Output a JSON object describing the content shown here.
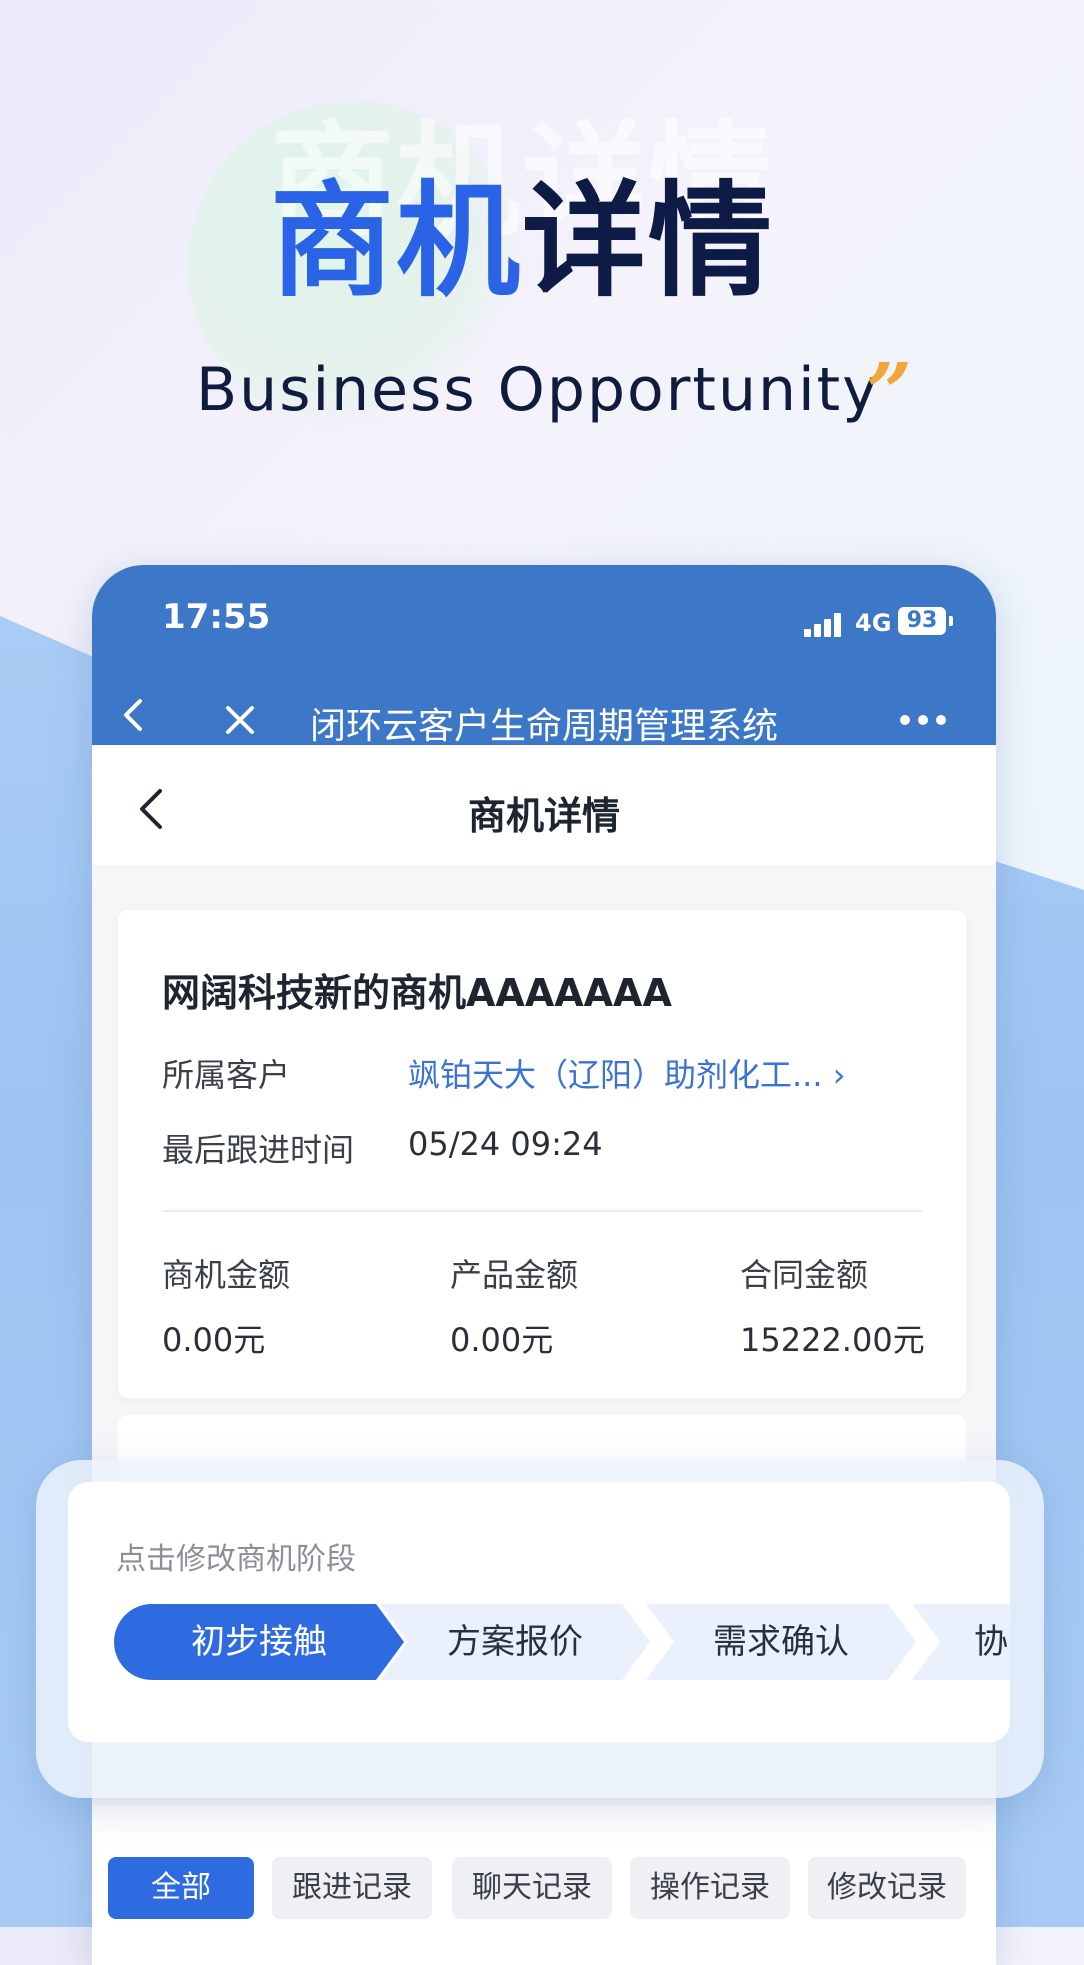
{
  "hero": {
    "title_part1": "商机",
    "title_part2": "详情",
    "ghost_text": "商机详情",
    "subtitle": "Business Opportunity",
    "quote_mark": "”"
  },
  "status_bar": {
    "time": "17:55",
    "network": "4G",
    "battery": "93"
  },
  "navbar": {
    "title": "闭环云客户生命周期管理系统"
  },
  "page": {
    "title": "商机详情"
  },
  "card": {
    "name": "网阔科技新的商机AAAAAAA",
    "customer_label": "所属客户",
    "customer_value": "飒铂天大（辽阳）助剂化工...  ›",
    "last_follow_label": "最后跟进时间",
    "last_follow_value": "05/24 09:24",
    "amounts": [
      {
        "label": "商机金额",
        "value": "0.00元"
      },
      {
        "label": "产品金额",
        "value": "0.00元"
      },
      {
        "label": "合同金额",
        "value": "15222.00元"
      }
    ]
  },
  "stage": {
    "hint": "点击修改商机阶段",
    "steps": [
      "初步接触",
      "方案报价",
      "需求确认",
      "协"
    ],
    "active_index": 0
  },
  "tabs": [
    "全部",
    "跟进记录",
    "聊天记录",
    "操作记录",
    "修改记录"
  ],
  "colors": {
    "primary": "#2F6BE0",
    "header": "#3C77C8",
    "link": "#3A72D6",
    "accent": "#F0A63A"
  }
}
